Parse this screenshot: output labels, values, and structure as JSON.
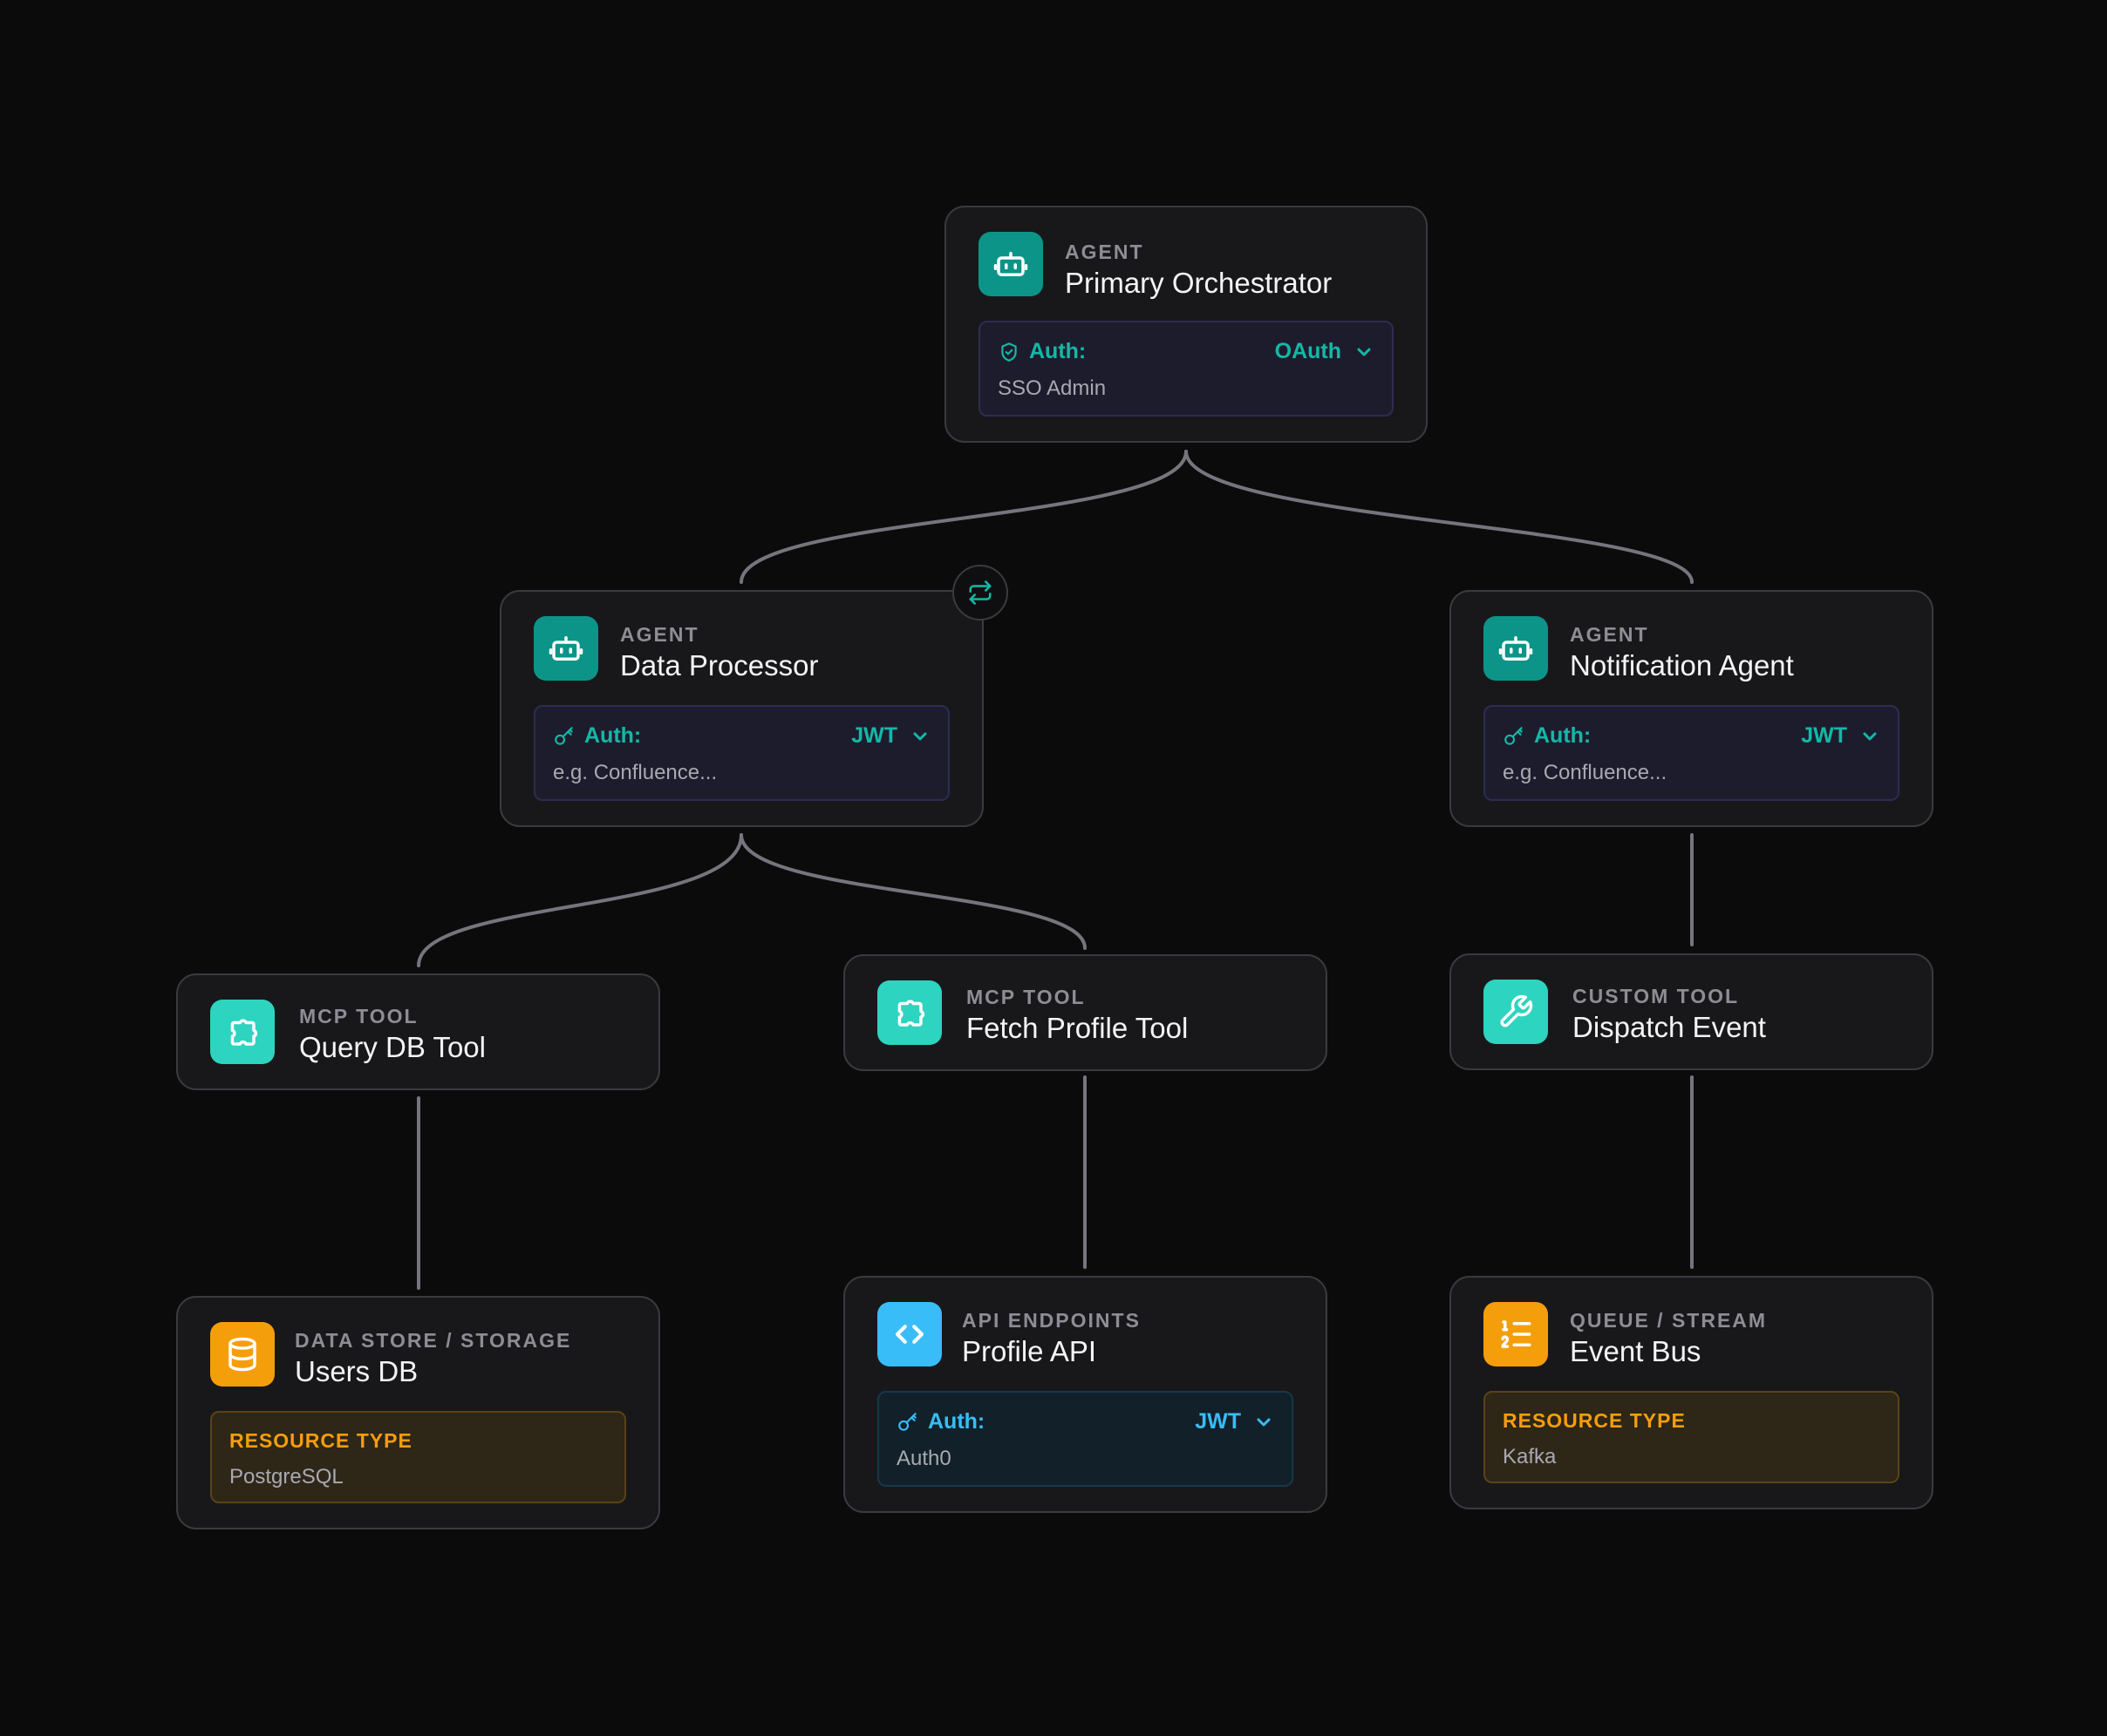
{
  "colors": {
    "background": "#0b0b0c",
    "node_bg": "#18181b",
    "node_border": "#3a3a3f",
    "edge": "#75757d",
    "agent_icon": "#0d9488",
    "tool_icon": "#2dd4bf",
    "api_icon": "#38bdf8",
    "store_icon": "#f59e0b",
    "auth_accent": "#14b8a6",
    "api_accent": "#38bdf8",
    "resource_accent": "#f59e0b"
  },
  "nodes": {
    "primary": {
      "kind": "AGENT",
      "name": "Primary Orchestrator",
      "icon": "robot-icon",
      "auth": {
        "label": "Auth:",
        "method": "OAuth",
        "value": "SSO Admin",
        "icon": "shield-check-icon"
      }
    },
    "processor": {
      "kind": "AGENT",
      "name": "Data Processor",
      "icon": "robot-icon",
      "auth": {
        "label": "Auth:",
        "method": "JWT",
        "value": "e.g. Confluence...",
        "icon": "key-icon"
      }
    },
    "notification": {
      "kind": "AGENT",
      "name": "Notification Agent",
      "icon": "robot-icon",
      "auth": {
        "label": "Auth:",
        "method": "JWT",
        "value": "e.g. Confluence...",
        "icon": "key-icon"
      }
    },
    "querydb": {
      "kind": "MCP TOOL",
      "name": "Query DB Tool",
      "icon": "puzzle-icon"
    },
    "fetchprofile": {
      "kind": "MCP TOOL",
      "name": "Fetch Profile Tool",
      "icon": "puzzle-icon"
    },
    "dispatch": {
      "kind": "CUSTOM TOOL",
      "name": "Dispatch Event",
      "icon": "wrench-icon"
    },
    "usersdb": {
      "kind": "DATA STORE / STORAGE",
      "name": "Users DB",
      "icon": "database-icon",
      "resource": {
        "label": "RESOURCE TYPE",
        "value": "PostgreSQL"
      }
    },
    "profileapi": {
      "kind": "API ENDPOINTS",
      "name": "Profile API",
      "icon": "code-icon",
      "auth": {
        "label": "Auth:",
        "method": "JWT",
        "value": "Auth0",
        "icon": "key-icon"
      }
    },
    "eventbus": {
      "kind": "QUEUE / STREAM",
      "name": "Event Bus",
      "icon": "list-ordered-icon",
      "resource": {
        "label": "RESOURCE TYPE",
        "value": "Kafka"
      }
    }
  },
  "edges": [
    {
      "from": "primary",
      "to": "processor"
    },
    {
      "from": "primary",
      "to": "notification"
    },
    {
      "from": "processor",
      "to": "querydb"
    },
    {
      "from": "processor",
      "to": "fetchprofile"
    },
    {
      "from": "notification",
      "to": "dispatch"
    },
    {
      "from": "querydb",
      "to": "usersdb"
    },
    {
      "from": "fetchprofile",
      "to": "profileapi"
    },
    {
      "from": "dispatch",
      "to": "eventbus"
    }
  ],
  "swap_button": {
    "icon": "swap-arrows-icon"
  }
}
